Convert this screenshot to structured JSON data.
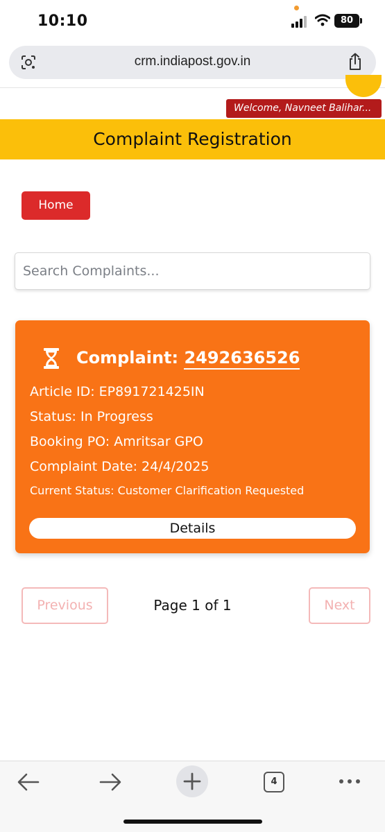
{
  "status_bar": {
    "time": "10:10",
    "battery": "80"
  },
  "browser": {
    "url": "crm.indiapost.gov.in",
    "tab_count": "4"
  },
  "welcome_text": "Welcome, Navneet Balihar...",
  "header": {
    "title": "Complaint Registration"
  },
  "home_button": "Home",
  "search": {
    "placeholder": "Search Complaints..."
  },
  "complaint": {
    "title_prefix": "Complaint: ",
    "number": "2492636526",
    "article_id": "Article ID: EP891721425IN",
    "status": "Status: In Progress",
    "booking_po": "Booking PO: Amritsar GPO",
    "complaint_date": "Complaint Date: 24/4/2025",
    "current_status": "Current Status: Customer Clarification Requested",
    "details_label": "Details"
  },
  "pagination": {
    "previous": "Previous",
    "next": "Next",
    "page_info": "Page 1 of 1"
  },
  "colors": {
    "header_yellow": "#fbbf0a",
    "card_orange": "#f97316",
    "home_red": "#dc2a2a",
    "welcome_red": "#b31b1b"
  }
}
